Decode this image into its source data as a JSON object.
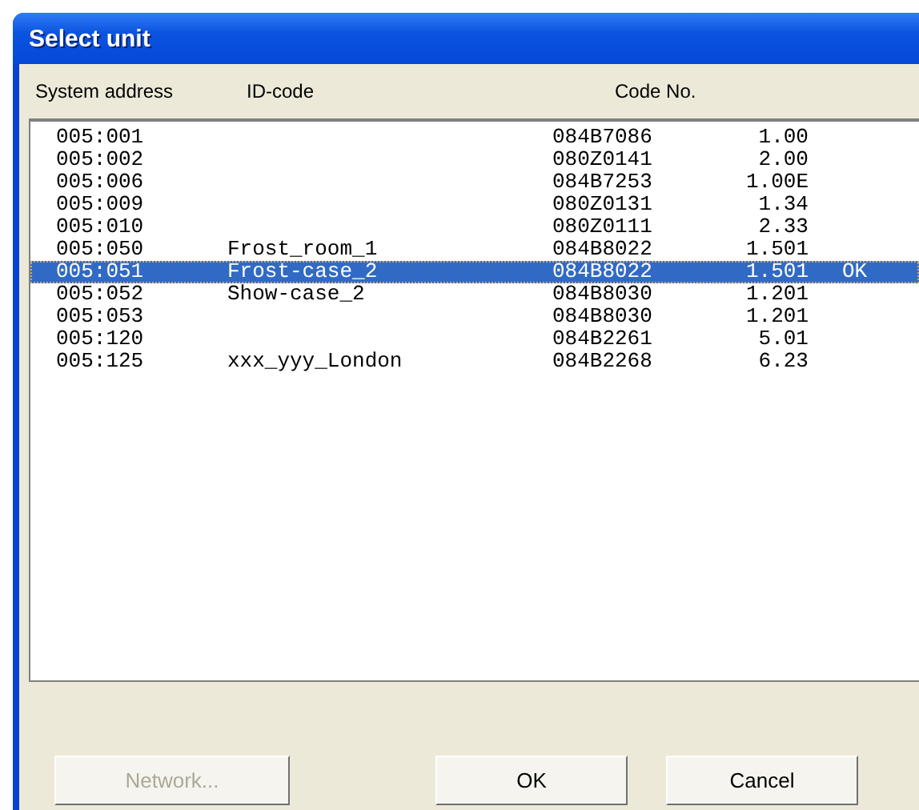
{
  "window": {
    "title": "Select unit"
  },
  "columns": [
    "System address",
    "ID-code",
    "Code No."
  ],
  "rows": [
    {
      "address": "005:001",
      "id_code": "",
      "code_no": "084B7086",
      "version": "1.00",
      "status": "",
      "selected": false
    },
    {
      "address": "005:002",
      "id_code": "",
      "code_no": "080Z0141",
      "version": "2.00",
      "status": "",
      "selected": false
    },
    {
      "address": "005:006",
      "id_code": "",
      "code_no": "084B7253",
      "version": "1.00E",
      "status": "",
      "selected": false
    },
    {
      "address": "005:009",
      "id_code": "",
      "code_no": "080Z0131",
      "version": "1.34",
      "status": "",
      "selected": false
    },
    {
      "address": "005:010",
      "id_code": "",
      "code_no": "080Z0111",
      "version": "2.33",
      "status": "",
      "selected": false
    },
    {
      "address": "005:050",
      "id_code": "Frost_room_1",
      "code_no": "084B8022",
      "version": "1.501",
      "status": "",
      "selected": false
    },
    {
      "address": "005:051",
      "id_code": "Frost-case_2",
      "code_no": "084B8022",
      "version": "1.501",
      "status": "OK",
      "selected": true
    },
    {
      "address": "005:052",
      "id_code": "Show-case_2",
      "code_no": "084B8030",
      "version": "1.201",
      "status": "",
      "selected": false
    },
    {
      "address": "005:053",
      "id_code": "",
      "code_no": "084B8030",
      "version": "1.201",
      "status": "",
      "selected": false
    },
    {
      "address": "005:120",
      "id_code": "",
      "code_no": "084B2261",
      "version": "5.01",
      "status": "",
      "selected": false
    },
    {
      "address": "005:125",
      "id_code": "xxx_yyy_London",
      "code_no": "084B2268",
      "version": "6.23",
      "status": "",
      "selected": false
    }
  ],
  "buttons": [
    {
      "label": "Network...",
      "disabled": true
    },
    {
      "label": "OK",
      "disabled": false
    },
    {
      "label": "Cancel",
      "disabled": false
    }
  ]
}
